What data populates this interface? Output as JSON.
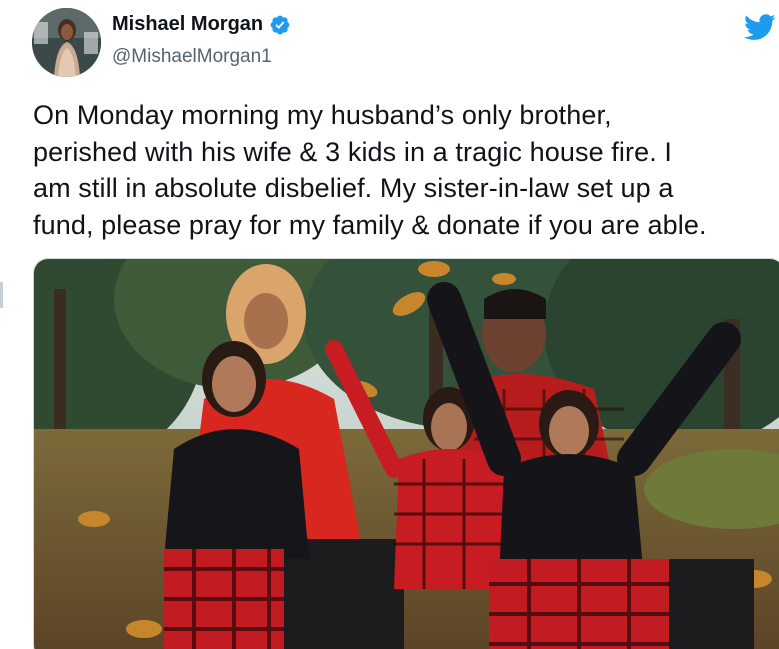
{
  "tweet": {
    "author": {
      "display_name": "Mishael Morgan",
      "handle": "@MishaelMorgan1",
      "verified": true,
      "avatar_icon": "profile-photo"
    },
    "brand_icon": "twitter-bird-icon",
    "text": "On Monday morning my husband’s only brother,\nperished with his wife & 3 kids in a tragic house fire. I\nam still in absolute disbelief. My sister-in-law set up a\nfund, please pray for my family & donate if you are able.",
    "media": {
      "type": "photo"
    }
  },
  "colors": {
    "text_primary": "#0f1419",
    "text_secondary": "#536471",
    "verified_badge": "#1d9bf0",
    "twitter_brand": "#1d9bf0",
    "border": "#cfd9de"
  }
}
